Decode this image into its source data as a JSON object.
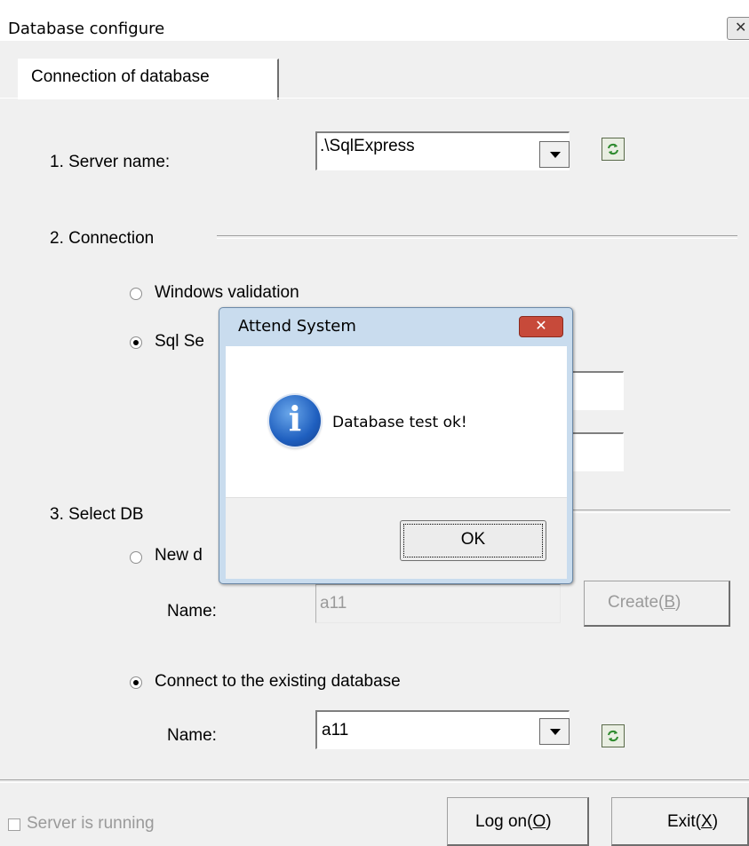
{
  "window": {
    "title": "Database configure",
    "close_glyph": "✕"
  },
  "tab": {
    "label": "Connection of database"
  },
  "server": {
    "label": "1. Server name:",
    "value": ".\\SqlExpress"
  },
  "connection": {
    "label": "2. Connection",
    "windows_validation": "Windows validation",
    "sql_server_partial": "Sql Se",
    "selected": "sql"
  },
  "select_db": {
    "label": "3. Select DB",
    "new_db_partial": "New d",
    "new_name_label": "Name:",
    "new_name_value": "a11",
    "create_button": "Create(",
    "create_key": "B",
    "create_close": ")",
    "existing_label": "Connect to the existing database",
    "existing_name_label": "Name:",
    "existing_name_value": "a11",
    "selected": "existing"
  },
  "footer": {
    "server_running": "Server is running",
    "logon_button": "Log on(",
    "logon_key": "O",
    "exit_button": "Exit(",
    "exit_key": "X",
    "close_paren": ")"
  },
  "dialog": {
    "title": "Attend System",
    "message": "Database test ok!",
    "ok_button": "OK",
    "close_glyph": "✕",
    "icon": "information-icon",
    "icon_glyph": "i"
  },
  "colors": {
    "dialog_frame": "#c9dcee",
    "dialog_close": "#c74a3a",
    "info_icon": "#1f5fbf"
  }
}
